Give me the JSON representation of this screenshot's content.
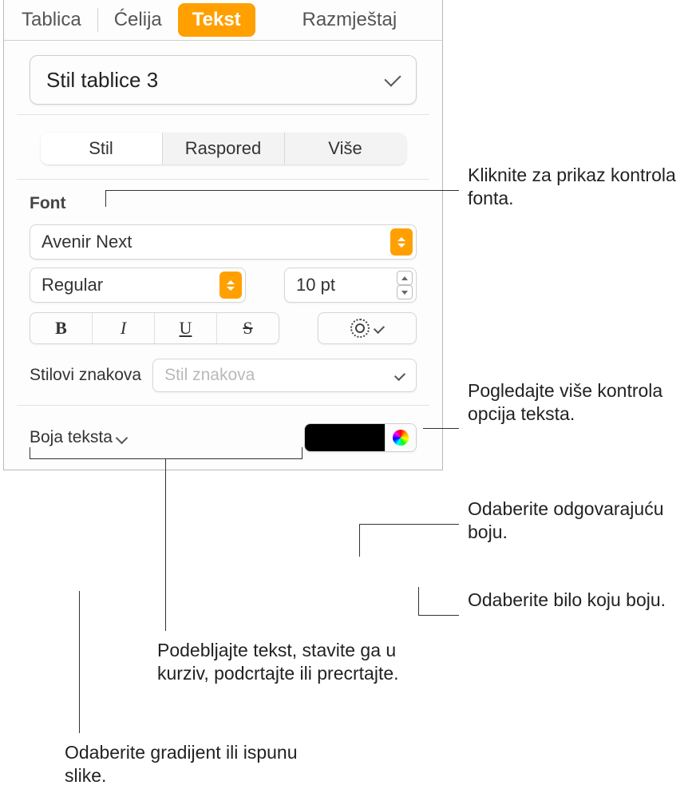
{
  "tabs": {
    "tablica": "Tablica",
    "celija": "Ćelija",
    "tekst": "Tekst",
    "razmjestaj": "Razmještaj"
  },
  "paragraphStyle": "Stil tablice 3",
  "subtabs": {
    "stil": "Stil",
    "raspored": "Raspored",
    "vise": "Više"
  },
  "fontSection": {
    "title": "Font",
    "family": "Avenir Next",
    "style": "Regular",
    "size": "10 pt"
  },
  "charStyles": {
    "label": "Stilovi znakova",
    "placeholder": "Stil znakova"
  },
  "textColor": {
    "label": "Boja teksta"
  },
  "callouts": {
    "stil": "Kliknite za prikaz kontrola fonta.",
    "gear": "Pogledajte više kontrola opcija teksta.",
    "swatch": "Odaberite odgovarajuću boju.",
    "wheel": "Odaberite bilo koju boju.",
    "bius": "Podebljajte tekst, stavite ga u kurziv, podcrtajte ili precrtajte.",
    "gradient": "Odaberite gradijent ili ispunu slike."
  }
}
